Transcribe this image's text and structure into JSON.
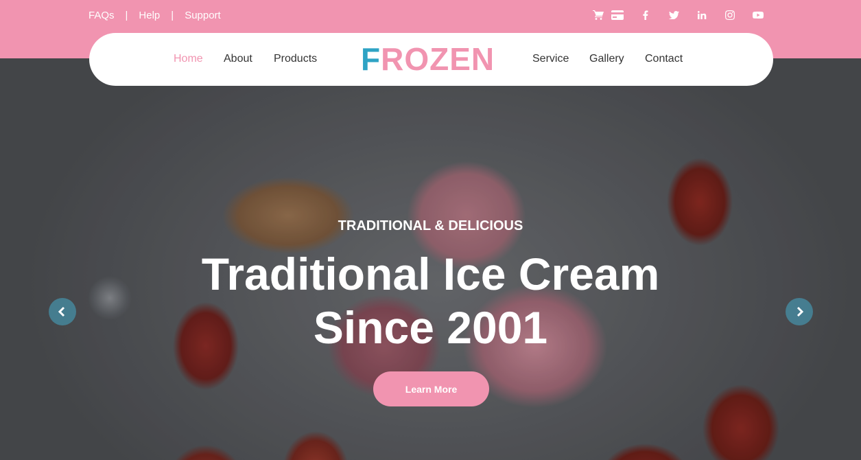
{
  "top_links": [
    "FAQs",
    "Help",
    "Support"
  ],
  "separator": "|",
  "social_icons": [
    "cart-icon",
    "credit-card-icon",
    "facebook-icon",
    "twitter-icon",
    "linkedin-icon",
    "instagram-icon",
    "youtube-icon"
  ],
  "nav": {
    "left": [
      "Home",
      "About",
      "Products"
    ],
    "right": [
      "Service",
      "Gallery",
      "Contact"
    ],
    "active": "Home"
  },
  "logo": {
    "first_letter": "F",
    "rest": "ROZEN"
  },
  "hero": {
    "subtitle": "TRADITIONAL & DELICIOUS",
    "title_line1": "Traditional Ice Cream",
    "title_line2": "Since 2001",
    "button": "Learn More"
  },
  "colors": {
    "accent_pink": "#f194b0",
    "logo_blue": "#2ea3c4"
  }
}
